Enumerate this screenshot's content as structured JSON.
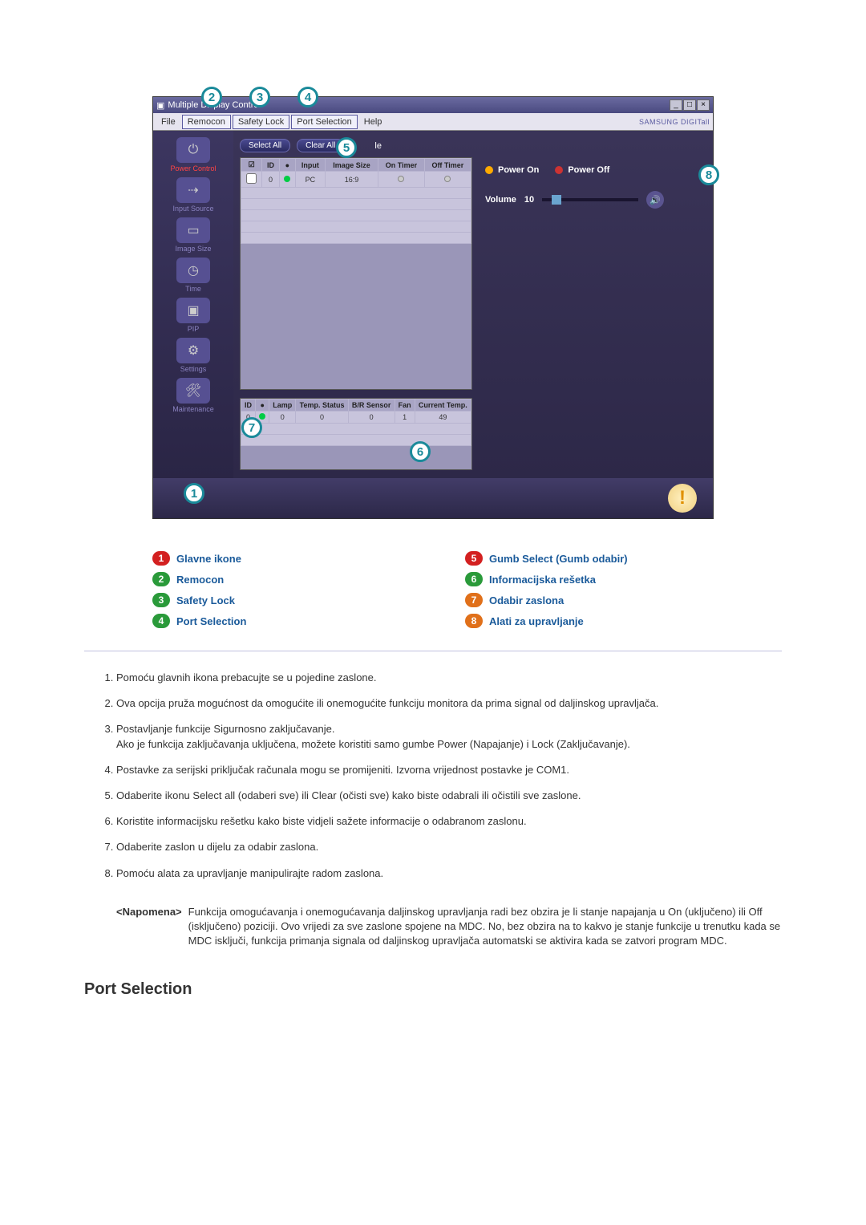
{
  "app": {
    "title": "Multiple Display Control",
    "brand": "SAMSUNG DIGITall",
    "menu": {
      "file": "File",
      "remocon": "Remocon",
      "safety_lock": "Safety Lock",
      "port_selection": "Port Selection",
      "help": "Help"
    },
    "sidebar": {
      "power_control": "Power Control",
      "input_source": "Input Source",
      "image_size": "Image Size",
      "time": "Time",
      "pip": "PIP",
      "settings": "Settings",
      "maintenance": "Maintenance"
    },
    "buttons": {
      "select_all": "Select All",
      "clear_all": "Clear All"
    },
    "selection_suffix": "le",
    "grid1": {
      "headers": [
        "",
        "ID",
        "",
        "Input",
        "Image Size",
        "On Timer",
        "Off Timer"
      ],
      "row": {
        "id": "0",
        "input": "PC",
        "size": "16:9"
      }
    },
    "grid2": {
      "headers": [
        "ID",
        "",
        "Lamp",
        "Temp. Status",
        "B/R Sensor",
        "Fan",
        "Current Temp."
      ],
      "row": {
        "id": "0",
        "lamp": "0",
        "temp_status": "0",
        "br": "0",
        "fan": "1",
        "cur_temp": "49"
      }
    },
    "controls": {
      "power_on": "Power On",
      "power_off": "Power Off",
      "volume_label": "Volume",
      "volume_value": "10"
    }
  },
  "legend": {
    "l1": "Glavne ikone",
    "l2": "Remocon",
    "l3": "Safety Lock",
    "l4": "Port Selection",
    "l5": "Gumb Select (Gumb odabir)",
    "l6": "Informacijska rešetka",
    "l7": "Odabir zaslona",
    "l8": "Alati za upravljanje"
  },
  "descriptions": {
    "d1": "Pomoću glavnih ikona prebacujte se u pojedine zaslone.",
    "d2": "Ova opcija pruža mogućnost da omogućite ili onemogućite funkciju monitora da prima signal od daljinskog upravljača.",
    "d3": "Postavljanje funkcije Sigurnosno zaključavanje.\nAko je funkcija zaključavanja uključena, možete koristiti samo gumbe Power (Napajanje) i Lock (Zaključavanje).",
    "d4": "Postavke za serijski priključak računala mogu se promijeniti. Izvorna vrijednost postavke je COM1.",
    "d5": "Odaberite ikonu Select all (odaberi sve) ili Clear (očisti sve) kako biste odabrali ili očistili sve zaslone.",
    "d6": "Koristite informacijsku rešetku kako biste vidjeli sažete informacije o odabranom zaslonu.",
    "d7": "Odaberite zaslon u dijelu za odabir zaslona.",
    "d8": "Pomoću alata za upravljanje manipulirajte radom zaslona."
  },
  "note": {
    "label": "<Napomena>",
    "text": "Funkcija omogućavanja i onemogućavanja daljinskog upravljanja radi bez obzira je li stanje napajanja u On (uključeno) ili Off (isključeno) poziciji. Ovo vrijedi za sve zaslone spojene na MDC. No, bez obzira na to kakvo je stanje funkcije u trenutku kada se MDC isključi, funkcija primanja signala od daljinskog upravljača automatski se aktivira kada se zatvori program MDC."
  },
  "section_title": "Port Selection"
}
